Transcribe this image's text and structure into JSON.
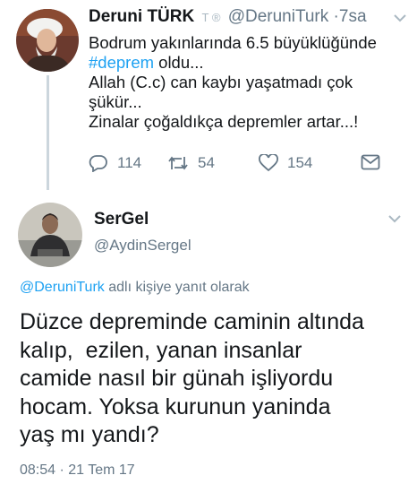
{
  "parent_tweet": {
    "display_name": "Deruni TÜRK",
    "badges": "T ®",
    "handle": "@DeruniTurk",
    "separator": "·",
    "time": "7sa",
    "text_lines": [
      "Bodrum yakınlarında 6.5 büyüklüğünde",
      "oldu...",
      "Allah (C.c) can kaybı yaşatmadı çok",
      "şükür...",
      "Zinalar çoğaldıkça depremler artar...!"
    ],
    "hashtag": "#deprem",
    "replies": "114",
    "retweets": "54",
    "likes": "154",
    "icons": [
      "reply-icon",
      "retweet-icon",
      "like-icon",
      "message-icon",
      "chevron-down-icon"
    ]
  },
  "reply_tweet": {
    "display_name": "SerGel",
    "handle": "@AydinSergel",
    "reply_to_mention": "@DeruniTurk",
    "reply_to_suffix": " adlı kişiye yanıt olarak",
    "body_lines": [
      "Düzce depreminde caminin altında",
      "kalıp,  ezilen, yanan insanlar",
      "camide nasıl bir günah işliyordu",
      "hocam. Yoksa kurunun yaninda",
      "yaş mı yandı?"
    ],
    "timestamp": "08:54 · 21 Tem 17"
  },
  "colors": {
    "accent": "#1da1f2",
    "muted": "#657786",
    "text": "#14171a",
    "thread_line": "#ccd6dd"
  }
}
